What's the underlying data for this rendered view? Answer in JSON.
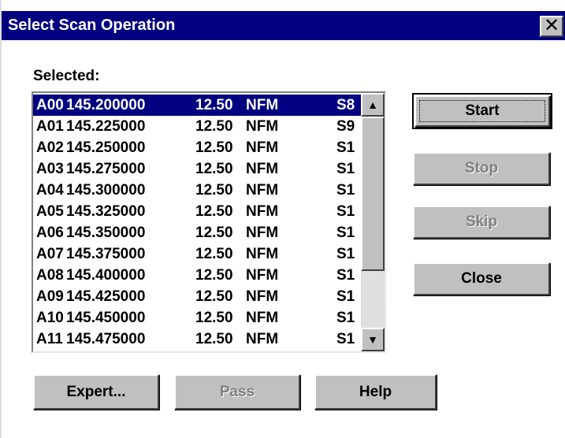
{
  "window": {
    "title": "Select Scan Operation",
    "close_glyph": "✕",
    "close_icon": "close-icon"
  },
  "list": {
    "label": "Selected:",
    "items": [
      {
        "id": "A00",
        "freq": "145.200000",
        "step": "12.50",
        "mode": "NFM",
        "ext": "S8",
        "selected": true
      },
      {
        "id": "A01",
        "freq": "145.225000",
        "step": "12.50",
        "mode": "NFM",
        "ext": "S9"
      },
      {
        "id": "A02",
        "freq": "145.250000",
        "step": "12.50",
        "mode": "NFM",
        "ext": "S1"
      },
      {
        "id": "A03",
        "freq": "145.275000",
        "step": "12.50",
        "mode": "NFM",
        "ext": "S1"
      },
      {
        "id": "A04",
        "freq": "145.300000",
        "step": "12.50",
        "mode": "NFM",
        "ext": "S1"
      },
      {
        "id": "A05",
        "freq": "145.325000",
        "step": "12.50",
        "mode": "NFM",
        "ext": "S1"
      },
      {
        "id": "A06",
        "freq": "145.350000",
        "step": "12.50",
        "mode": "NFM",
        "ext": "S1"
      },
      {
        "id": "A07",
        "freq": "145.375000",
        "step": "12.50",
        "mode": "NFM",
        "ext": "S1"
      },
      {
        "id": "A08",
        "freq": "145.400000",
        "step": "12.50",
        "mode": "NFM",
        "ext": "S1"
      },
      {
        "id": "A09",
        "freq": "145.425000",
        "step": "12.50",
        "mode": "NFM",
        "ext": "S1"
      },
      {
        "id": "A10",
        "freq": "145.450000",
        "step": "12.50",
        "mode": "NFM",
        "ext": "S1"
      },
      {
        "id": "A11",
        "freq": "145.475000",
        "step": "12.50",
        "mode": "NFM",
        "ext": "S1"
      }
    ],
    "scroll_up_glyph": "▲",
    "scroll_down_glyph": "▼"
  },
  "buttons": {
    "start": "Start",
    "stop": "Stop",
    "skip": "Skip",
    "close": "Close",
    "expert": "Expert...",
    "pass": "Pass",
    "help": "Help"
  },
  "colors": {
    "titlebar": "#000080",
    "selection": "#000080",
    "face": "#c0c0c0",
    "disabled_text": "#808080"
  }
}
